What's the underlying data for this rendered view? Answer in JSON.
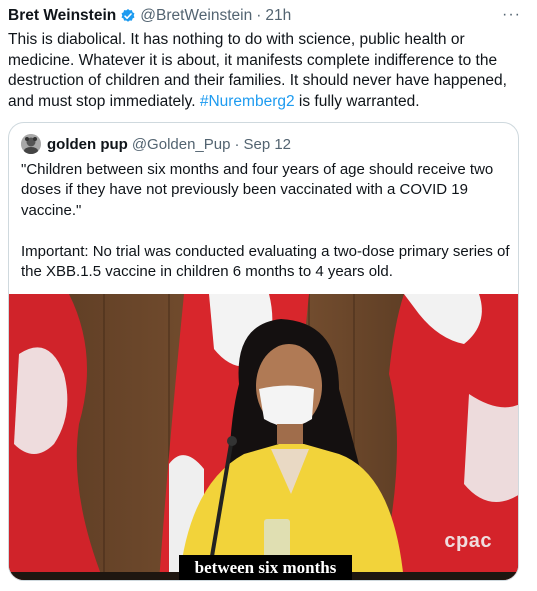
{
  "tweet": {
    "author_name": "Bret Weinstein",
    "handle": "@BretWeinstein",
    "separator": "·",
    "time": "21h",
    "more_label": "···",
    "text_main": "This is diabolical. It has nothing to do with science, public health or medicine. Whatever it is about, it manifests  complete indifference to the destruction of children and their families. It should never have happened, and must stop immediately. ",
    "hashtag": "#Nuremberg2",
    "text_tail": " is fully warranted."
  },
  "quote": {
    "author_name": "golden pup",
    "handle": "@Golden_Pup",
    "separator": "·",
    "date": "Sep 12",
    "paragraph1": "\"Children between six months and four years of age should receive two doses if they have not previously been vaccinated with a COVID 19 vaccine.\"",
    "paragraph2": "Important: No trial was conducted evaluating a two-dose primary series of the XBB.1.5 vaccine in children 6 months to 4 years old.",
    "media": {
      "caption": "between six months",
      "logo": "cpac"
    }
  },
  "colors": {
    "link": "#1d9bf0",
    "verified": "#1d9bf0",
    "muted": "#536471",
    "blazer": "#f2d33a",
    "flag_red": "#d0232a"
  }
}
